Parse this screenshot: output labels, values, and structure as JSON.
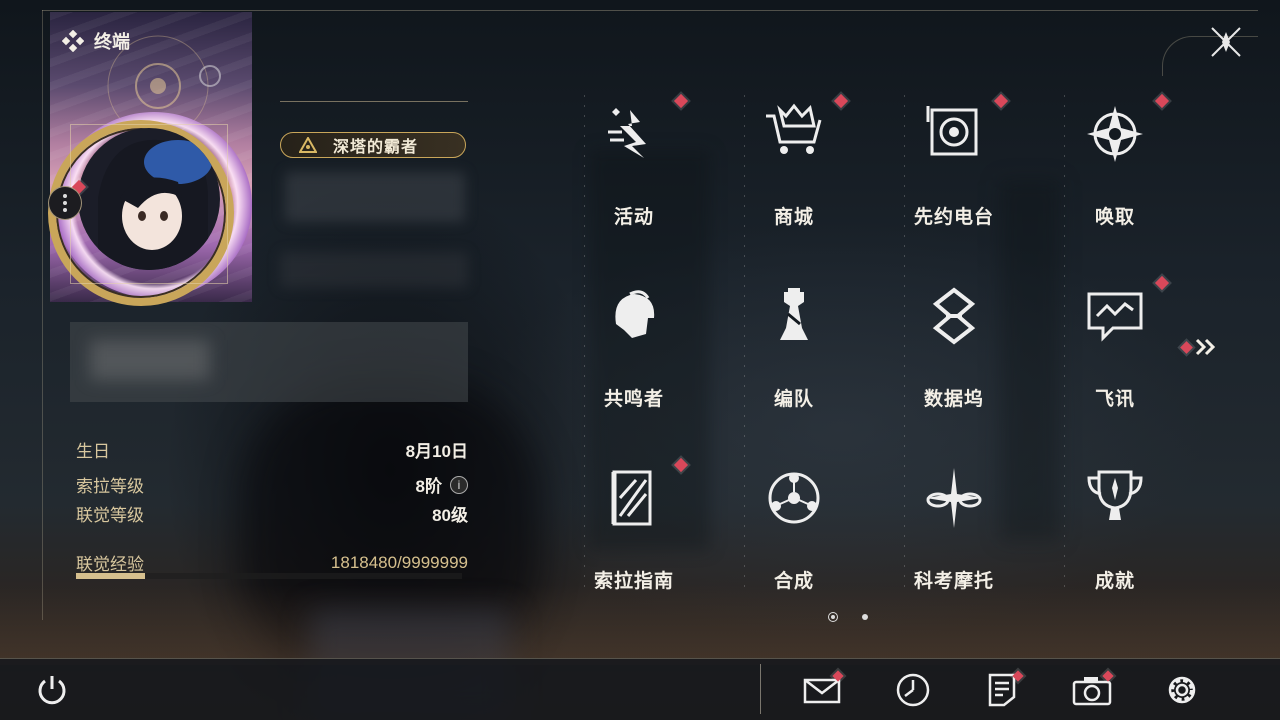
{
  "terminal": {
    "label": "终端",
    "icon": "diamond-cluster-icon"
  },
  "profile": {
    "title_badge": "深塔的霸者",
    "menu_icon": "more-dots-icon"
  },
  "info": {
    "birthday_label": "生日",
    "birthday_value": "8月10日",
    "sola_level_label": "索拉等级",
    "sola_level_value": "8阶",
    "info_icon": "i",
    "union_level_label": "联觉等级",
    "union_level_value": "80级",
    "union_exp_label": "联觉经验",
    "union_exp_value": "1818480/9999999",
    "union_exp_progress": 0.18
  },
  "menu": {
    "items": [
      {
        "label": "活动",
        "icon": "sparkle-events-icon",
        "badge": true
      },
      {
        "label": "商城",
        "icon": "shop-cart-icon",
        "badge": true
      },
      {
        "label": "先约电台",
        "icon": "radio-speaker-icon",
        "badge": true
      },
      {
        "label": "唤取",
        "icon": "compass-star-icon",
        "badge": true
      },
      {
        "label": "共鸣者",
        "icon": "resonator-head-icon",
        "badge": false
      },
      {
        "label": "编队",
        "icon": "chess-tower-icon",
        "badge": false
      },
      {
        "label": "数据坞",
        "icon": "data-dock-icon",
        "badge": false
      },
      {
        "label": "飞讯",
        "icon": "chat-message-icon",
        "badge": true
      },
      {
        "label": "索拉指南",
        "icon": "guide-book-icon",
        "badge": true
      },
      {
        "label": "合成",
        "icon": "synthesis-orb-icon",
        "badge": false
      },
      {
        "label": "科考摩托",
        "icon": "motorbike-icon",
        "badge": false
      },
      {
        "label": "成就",
        "icon": "trophy-icon",
        "badge": false
      }
    ],
    "next_page_icon": "double-chevron-right-icon",
    "page_count": 2,
    "current_page": 1
  },
  "bottom": {
    "power_icon": "power-icon",
    "mail_icon": "mail-icon",
    "clock_icon": "clock-icon",
    "notes_icon": "notes-icon",
    "camera_icon": "camera-icon",
    "settings_icon": "gear-icon"
  },
  "colors": {
    "accent_gold": "#c9a65a",
    "badge_red": "#d9485a",
    "text": "#f3efe6",
    "label_gold": "#d8c79e"
  }
}
